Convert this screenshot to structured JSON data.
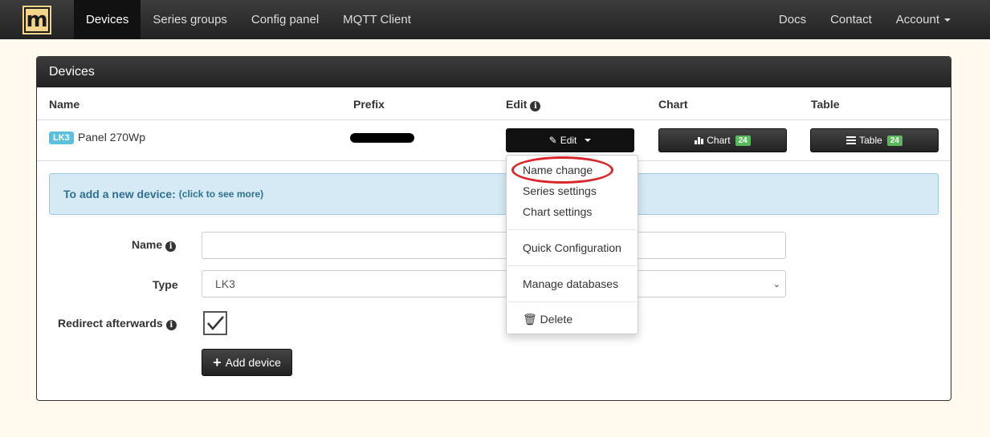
{
  "navbar": {
    "logo": "m",
    "items": [
      "Devices",
      "Series groups",
      "Config panel",
      "MQTT Client"
    ],
    "right_items": [
      "Docs",
      "Contact",
      "Account"
    ]
  },
  "panel": {
    "title": "Devices",
    "columns": [
      "Name",
      "Prefix",
      "Edit",
      "Chart",
      "Table"
    ],
    "row": {
      "type_label": "LK3",
      "name": "Panel 270Wp",
      "edit_button": "Edit",
      "chart_button": "Chart",
      "chart_count": "24",
      "table_button": "Table",
      "table_count": "24"
    },
    "alert": {
      "title": "To add a new device:",
      "hint": "(click to see more)"
    },
    "form": {
      "name_label": "Name",
      "name_value": "",
      "type_label": "Type",
      "type_value": "LK3",
      "redirect_label": "Redirect afterwards",
      "redirect_checked": true,
      "add_button": "Add device"
    }
  },
  "dropdown": {
    "items": [
      "Name change",
      "Series settings",
      "Chart settings",
      "Quick Configuration",
      "Manage databases",
      "Delete"
    ]
  },
  "colors": {
    "accent_label": "#5bc0de",
    "badge": "#5cb85c",
    "highlight": "#d9262c",
    "background": "#fff9ee"
  }
}
